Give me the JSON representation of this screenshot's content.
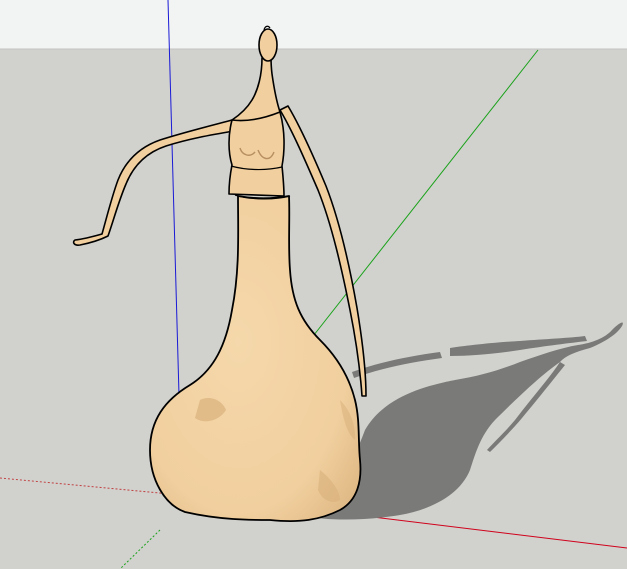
{
  "app": {
    "kind": "3d-modeling-viewport"
  },
  "scene": {
    "sky_color": "#f2f3f3",
    "ground_color": "#d1d1ce",
    "model": {
      "name": "figurine-sculpture",
      "fill_color": "#f1cf9e",
      "shade_color": "#d6ad7a",
      "edge_color": "#000000"
    },
    "shadow_color": "#7b7b79",
    "axes": {
      "red_axis_color": "#d0021b",
      "green_axis_color": "#1aa31a",
      "blue_axis_color": "#1a1ad6",
      "shows_dotted_negative_axes": true
    },
    "shadows_enabled": true
  }
}
